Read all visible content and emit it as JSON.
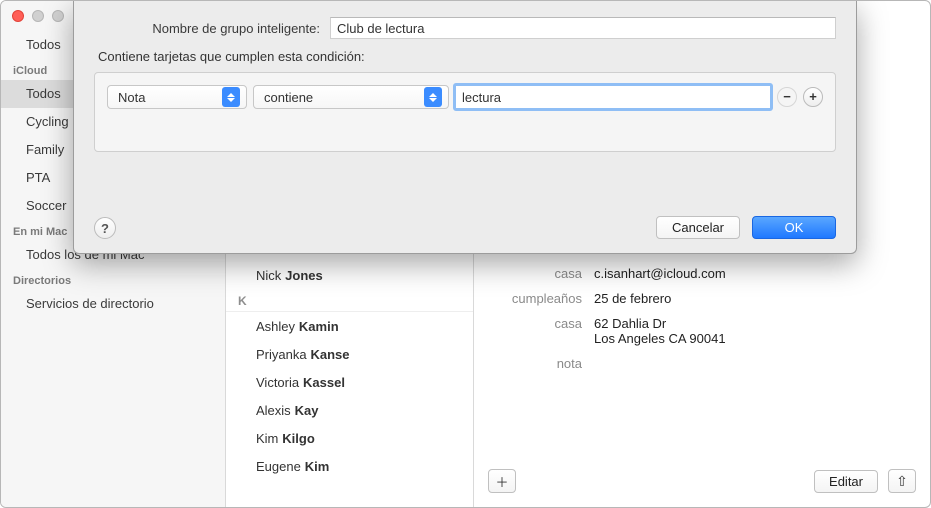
{
  "sidebar": {
    "top_items": [
      "Todos"
    ],
    "sections": [
      {
        "header": "iCloud",
        "items": [
          "Todos",
          "Cycling",
          "Family",
          "PTA",
          "Soccer"
        ],
        "selected_index": 0
      },
      {
        "header": "En mi Mac",
        "items": [
          "Todos los de mi Mac"
        ]
      },
      {
        "header": "Directorios",
        "items": [
          "Servicios de directorio"
        ]
      }
    ]
  },
  "contacts": {
    "initial_name": {
      "first": "Nick",
      "last": "Jones"
    },
    "section_letter": "K",
    "list": [
      {
        "first": "Ashley",
        "last": "Kamin"
      },
      {
        "first": "Priyanka",
        "last": "Kanse"
      },
      {
        "first": "Victoria",
        "last": "Kassel"
      },
      {
        "first": "Alexis",
        "last": "Kay"
      },
      {
        "first": "Kim",
        "last": "Kilgo"
      },
      {
        "first": "Eugene",
        "last": "Kim"
      }
    ]
  },
  "detail": {
    "fields": [
      {
        "label": "casa",
        "value": "c.isanhart@icloud.com"
      },
      {
        "label": "cumpleaños",
        "value": "25 de febrero"
      },
      {
        "label": "casa",
        "value": "62 Dahlia Dr\nLos Angeles CA 90041"
      },
      {
        "label": "nota",
        "value": ""
      }
    ],
    "edit_label": "Editar"
  },
  "sheet": {
    "name_label": "Nombre de grupo inteligente:",
    "name_value": "Club de lectura",
    "condition_intro": "Contiene tarjetas que cumplen esta condición:",
    "field_popup": "Nota",
    "op_popup": "contiene",
    "value_input": "lectura",
    "cancel": "Cancelar",
    "ok": "OK",
    "help": "?"
  }
}
